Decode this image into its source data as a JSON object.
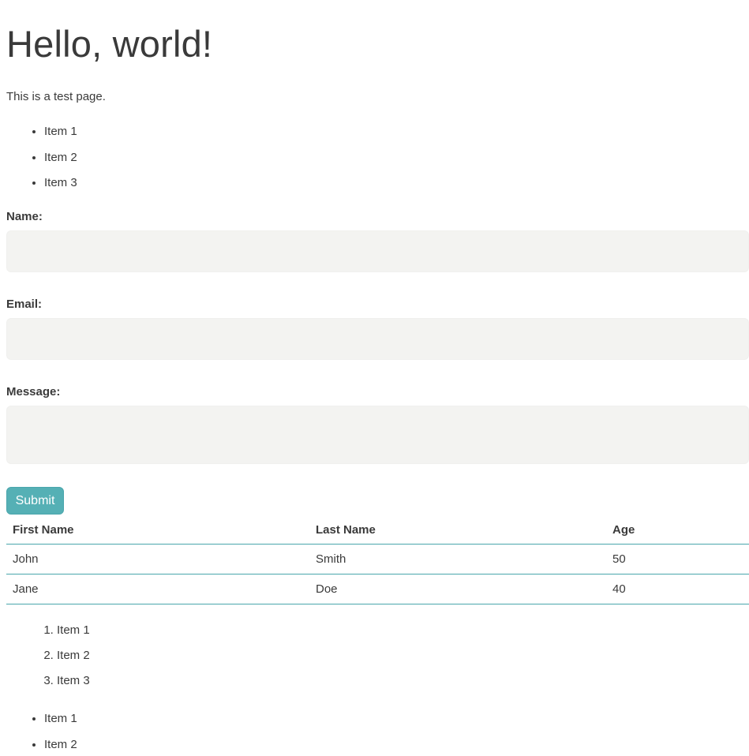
{
  "heading": "Hello, world!",
  "intro": "This is a test page.",
  "list_top": [
    "Item 1",
    "Item 2",
    "Item 3"
  ],
  "form": {
    "name_label": "Name:",
    "name_value": "",
    "email_label": "Email:",
    "email_value": "",
    "message_label": "Message:",
    "message_value": "",
    "submit_label": "Submit"
  },
  "table": {
    "headers": [
      "First Name",
      "Last Name",
      "Age"
    ],
    "rows": [
      [
        "John",
        "Smith",
        "50"
      ],
      [
        "Jane",
        "Doe",
        "40"
      ]
    ]
  },
  "ordered_list": [
    "Item 1",
    "Item 2",
    "Item 3"
  ],
  "list_bottom": [
    "Item 1",
    "Item 2"
  ],
  "colors": {
    "text": "#3a3a3a",
    "input_background": "#f3f3f1",
    "accent": "#55b0b5",
    "table_border": "#4aa6ac"
  }
}
